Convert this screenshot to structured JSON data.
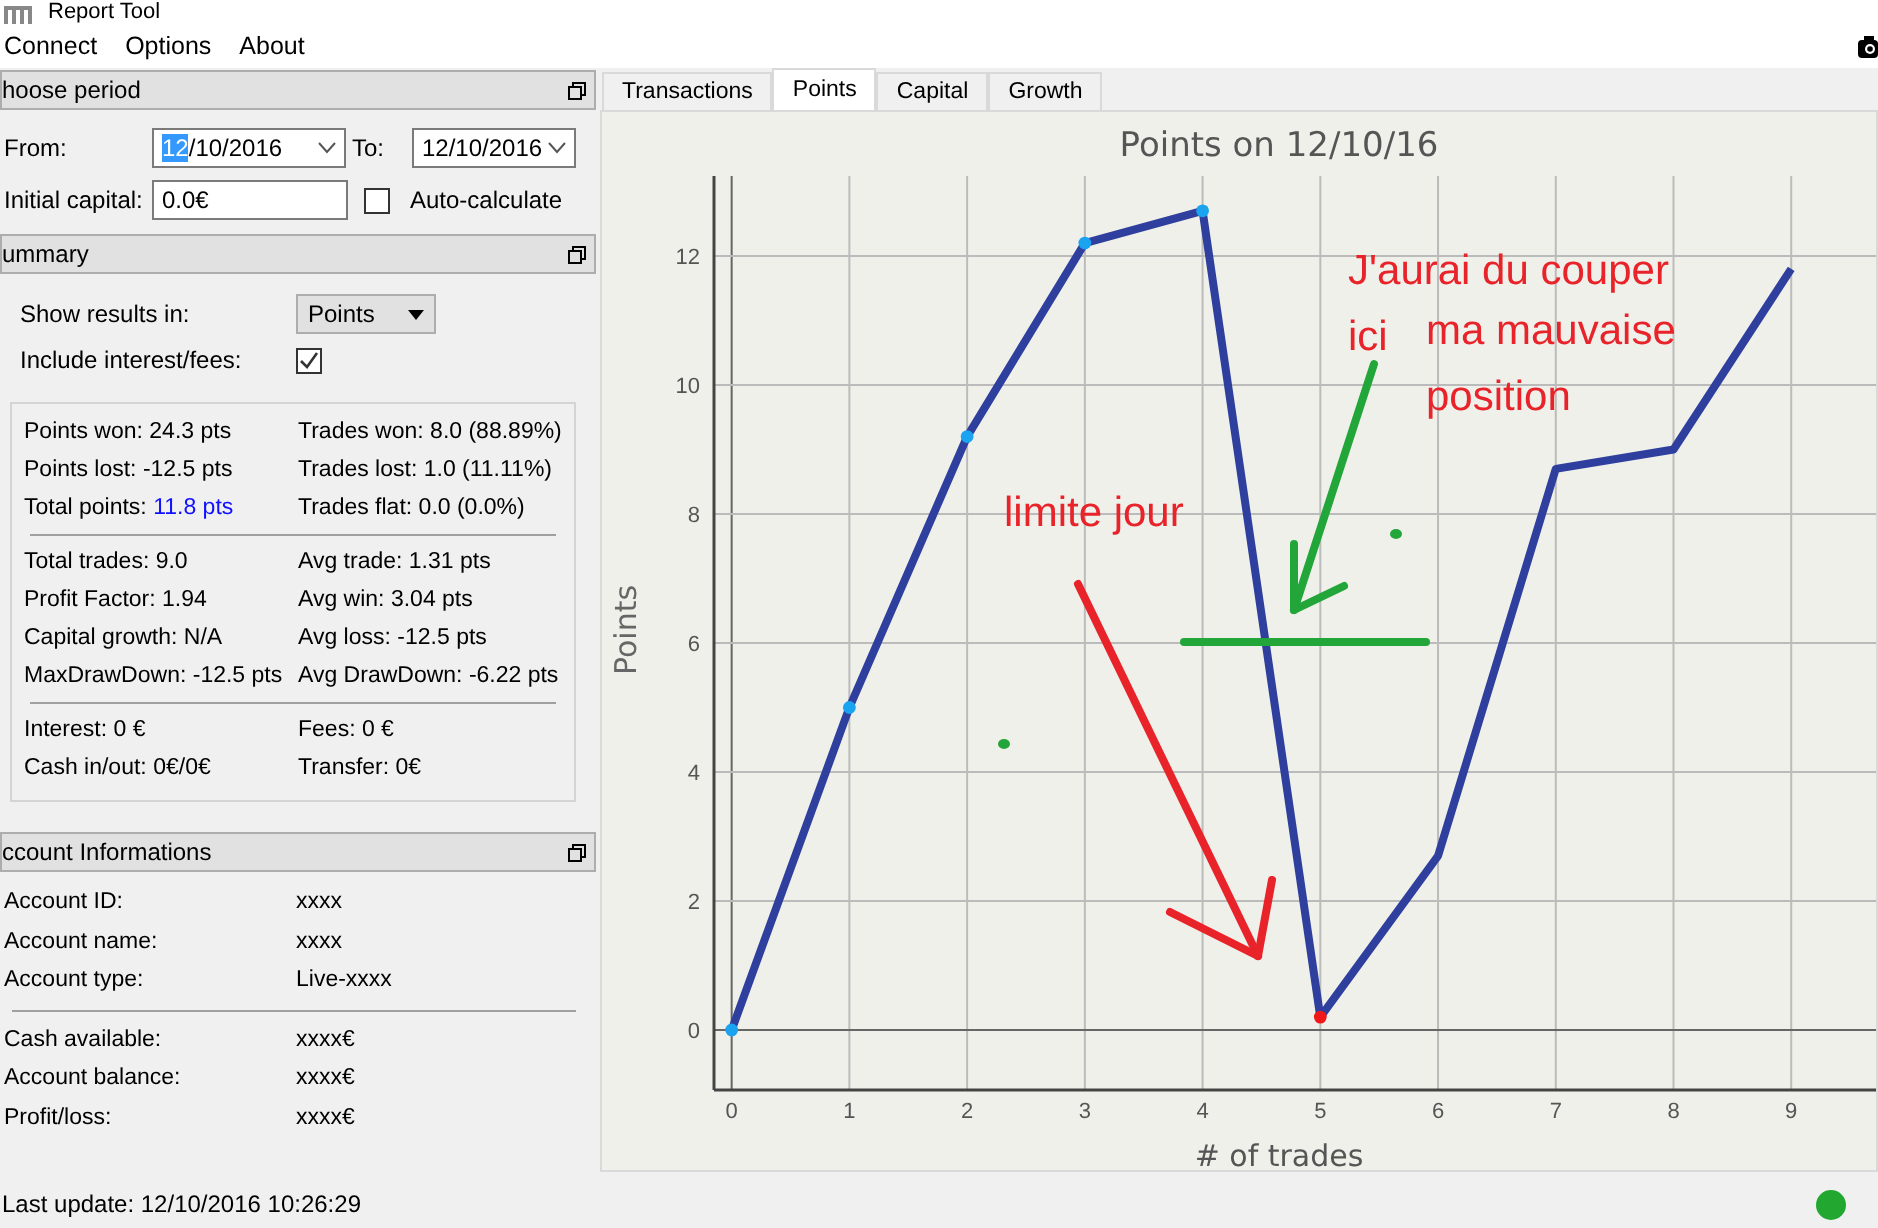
{
  "window": {
    "title": "Report Tool"
  },
  "menu": [
    {
      "label": "Connect"
    },
    {
      "label": "Options"
    },
    {
      "label": "About"
    }
  ],
  "period": {
    "title": "hoose period",
    "from_label": "From:",
    "from_value_parts": [
      {
        "text": "12",
        "selected": true
      },
      {
        "text": "/10/2016",
        "selected": false
      }
    ],
    "to_label": "To:",
    "to_value": "12/10/2016",
    "capital_label": "Initial capital:",
    "capital_value": "0.0€",
    "auto_label": "Auto-calculate",
    "auto_checked": false
  },
  "summary": {
    "title": "ummary",
    "show_label": "Show results in:",
    "show_value": "Points",
    "include_label": "Include interest/fees:",
    "include_checked": true,
    "groups": [
      [
        {
          "label": "Points won:",
          "value": "24.3 pts",
          "highlighted": false
        },
        {
          "label": "Trades won:",
          "value": "8.0 (88.89%)",
          "highlighted": false
        },
        {
          "label": "Points lost:",
          "value": "-12.5 pts",
          "highlighted": false
        },
        {
          "label": "Trades lost:",
          "value": "1.0 (11.11%)",
          "highlighted": false
        },
        {
          "label": "Total points:",
          "value": "11.8 pts",
          "highlighted": true
        },
        {
          "label": "Trades flat:",
          "value": "0.0 (0.0%)",
          "highlighted": false
        }
      ],
      [
        {
          "label": "Total trades:",
          "value": "9.0",
          "highlighted": false
        },
        {
          "label": "Avg trade:",
          "value": "1.31 pts",
          "highlighted": false
        },
        {
          "label": "Profit Factor:",
          "value": "1.94",
          "highlighted": false
        },
        {
          "label": "Avg win:",
          "value": "3.04 pts",
          "highlighted": false
        },
        {
          "label": "Capital growth:",
          "value": "N/A",
          "highlighted": false
        },
        {
          "label": "Avg loss:",
          "value": "-12.5 pts",
          "highlighted": false
        },
        {
          "label": "MaxDrawDown:",
          "value": "-12.5 pts",
          "highlighted": false
        },
        {
          "label": "Avg DrawDown:",
          "value": "-6.22 pts",
          "highlighted": false
        }
      ],
      [
        {
          "label": "Interest:",
          "value": "0 €",
          "highlighted": false
        },
        {
          "label": "Fees:",
          "value": "0 €",
          "highlighted": false
        },
        {
          "label": "Cash in/out:",
          "value": "0€/0€",
          "highlighted": false
        },
        {
          "label": "Transfer:",
          "value": "0€",
          "highlighted": false
        }
      ]
    ]
  },
  "account": {
    "title": "ccount Informations",
    "groups": [
      [
        {
          "label": "Account ID:",
          "value": "xxxx"
        },
        {
          "label": "Account name:",
          "value": "xxxx"
        },
        {
          "label": "Account type:",
          "value": "Live-xxxx"
        }
      ],
      [
        {
          "label": "Cash available:",
          "value": "xxxx€"
        },
        {
          "label": "Account balance:",
          "value": "xxxx€"
        },
        {
          "label": "Profit/loss:",
          "value": "xxxx€"
        }
      ]
    ]
  },
  "tabs": [
    {
      "label": "Transactions",
      "selected": false
    },
    {
      "label": "Points",
      "selected": true
    },
    {
      "label": "Capital",
      "selected": false
    },
    {
      "label": "Growth",
      "selected": false
    }
  ],
  "chart": {
    "chart_data": {
      "type": "line",
      "title": "Points on 12/10/16",
      "xlabel": "# of trades",
      "ylabel": "Points",
      "x": [
        0,
        1,
        2,
        3,
        4,
        5,
        6,
        7,
        8,
        9
      ],
      "series": [
        {
          "color": "#2f3f9e",
          "values": [
            0,
            5,
            9.2,
            12.2,
            12.7,
            0.2,
            2.7,
            8.7,
            9,
            11.8
          ]
        },
        {
          "type": "scatter",
          "color": "#1aa3f0",
          "values": [
            0,
            5,
            9.2,
            12.2,
            12.7,
            null,
            null,
            null,
            null,
            null
          ]
        },
        {
          "type": "scatter",
          "color": "#f01818",
          "values": [
            null,
            null,
            null,
            null,
            null,
            0.2,
            null,
            null,
            null,
            null
          ]
        }
      ],
      "xlim": [
        -0.15,
        9.72
      ],
      "ylim": [
        -0.93,
        13.24
      ],
      "xticks": [
        0,
        1,
        2,
        3,
        4,
        5,
        6,
        7,
        8,
        9
      ],
      "yticks": [
        0,
        2,
        4,
        6,
        8,
        10,
        12
      ],
      "grid": true,
      "annotations": [
        "J'aurai du couper",
        "ici",
        "ma mauvaise",
        "position",
        "limite jour"
      ]
    }
  },
  "status_bar": {
    "text": "Last update: 12/10/2016 10:26:29",
    "connected": true
  }
}
